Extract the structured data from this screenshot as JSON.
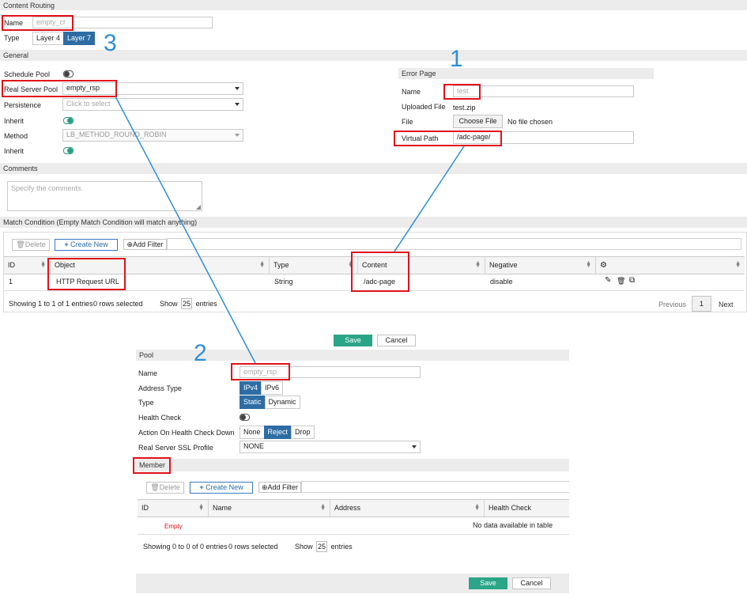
{
  "content_routing": {
    "section_title": "Content Routing",
    "name_label": "Name",
    "name_placeholder": "empty_cr",
    "type_label": "Type",
    "type_options": [
      "Layer 4",
      "Layer 7"
    ],
    "type_selected": "Layer 7",
    "general_title": "General",
    "schedule_pool_label": "Schedule Pool",
    "schedule_pool_on": false,
    "real_server_pool_label": "Real Server Pool",
    "real_server_pool_value": "empty_rsp",
    "persistence_label": "Persistence",
    "persistence_placeholder": "Click to select",
    "inherit_label": "Inherit",
    "inherit_on": true,
    "method_label": "Method",
    "method_value": "LB_METHOD_ROUND_ROBIN",
    "inherit2_label": "Inherit",
    "inherit2_on": true,
    "error_page": {
      "title": "Error Page",
      "name_label": "Name",
      "name_placeholder": "test",
      "uploaded_file_label": "Uploaded File",
      "uploaded_file_value": "test.zip",
      "file_label": "File",
      "choose_file_label": "Choose File",
      "no_file_text": "No file chosen",
      "virtual_path_label": "Virtual Path",
      "virtual_path_value": "/adc-page/"
    },
    "comments_title": "Comments",
    "comments_placeholder": "Specify the comments.",
    "match_title": "Match Condition (Empty Match Condition will match anything)",
    "toolbar": {
      "delete_label": "Delete",
      "create_label": "Create New",
      "filter_label": "Add Filter"
    },
    "columns": [
      "ID",
      "Object",
      "Type",
      "Content",
      "Negative"
    ],
    "rows": [
      {
        "id": "1",
        "object": "HTTP Request URL",
        "type": "String",
        "content": "/adc-page",
        "negative": "disable"
      }
    ],
    "footer": {
      "showing": "Showing 1 to 1 of 1 entries",
      "selected": "0 rows selected",
      "show_label": "Show",
      "show_count": "25",
      "entries_label": "entries",
      "previous": "Previous",
      "page": "1",
      "next": "Next"
    },
    "save_label": "Save",
    "cancel_label": "Cancel"
  },
  "pool": {
    "section_title": "Pool",
    "name_label": "Name",
    "name_placeholder": "empty_rsp",
    "address_type_label": "Address Type",
    "address_type_options": [
      "IPv4",
      "IPv6"
    ],
    "address_type_selected": "IPv4",
    "type_label": "Type",
    "type_options": [
      "Static",
      "Dynamic"
    ],
    "type_selected": "Static",
    "health_check_label": "Health Check",
    "health_check_on": false,
    "action_label": "Action On Health Check Down",
    "action_options": [
      "None",
      "Reject",
      "Drop"
    ],
    "action_selected": "Reject",
    "ssl_profile_label": "Real Server SSL Profile",
    "ssl_profile_value": "NONE",
    "member_title": "Member",
    "toolbar": {
      "delete_label": "Delete",
      "create_label": "Create New",
      "filter_label": "Add Filter"
    },
    "columns": [
      "ID",
      "Name",
      "Address",
      "Health Check"
    ],
    "empty_label": "Empty",
    "no_data": "No data available in table",
    "footer": {
      "showing": "Showing 0 to 0 of 0 entries",
      "selected": "0 rows selected",
      "show_label": "Show",
      "show_count": "25",
      "entries_label": "entries"
    },
    "save_label": "Save",
    "cancel_label": "Cancel"
  },
  "annotations": {
    "n1": "1",
    "n2": "2",
    "n3": "3"
  },
  "colors": {
    "annotation_red": "#e0121a",
    "annotation_blue": "#2f8ed6",
    "save_green": "#2aa587",
    "selected_blue": "#2e6da4"
  }
}
